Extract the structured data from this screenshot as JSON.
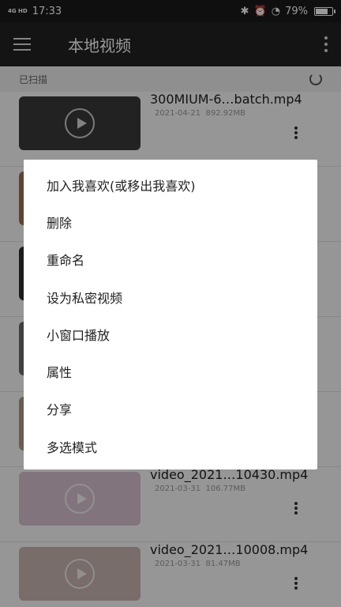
{
  "status_bar": {
    "network": "4G HD",
    "time": "17:33",
    "battery_text": "79%",
    "battery_level": 0.79
  },
  "toolbar": {
    "title": "本地视频"
  },
  "scan": {
    "label": "已扫描"
  },
  "videos": [
    {
      "title": "300MIUM-6…batch.mp4",
      "date": "2021-04-21",
      "size": "892.92MB",
      "thumb_color": "#3a3a3a"
    },
    {
      "title": "",
      "date": "",
      "size": "",
      "thumb_color": "#a0704a"
    },
    {
      "title": "",
      "date": "",
      "size": "",
      "thumb_color": "#2e2e2e"
    },
    {
      "title": "",
      "date": "",
      "size": "",
      "thumb_color": "#6b6b6b"
    },
    {
      "title": "",
      "date": "",
      "size": "",
      "thumb_color": "#b09a86"
    },
    {
      "title": "video_2021…10430.mp4",
      "date": "2021-03-31",
      "size": "106.77MB",
      "thumb_color": "#d7c2cf"
    },
    {
      "title": "video_2021…10008.mp4",
      "date": "2021-03-31",
      "size": "81.47MB",
      "thumb_color": "#c8b6b1"
    }
  ],
  "context_menu": {
    "items": [
      "加入我喜欢(或移出我喜欢)",
      "删除",
      "重命名",
      "设为私密视频",
      "小窗口播放",
      "属性",
      "分享",
      "多选模式"
    ]
  }
}
